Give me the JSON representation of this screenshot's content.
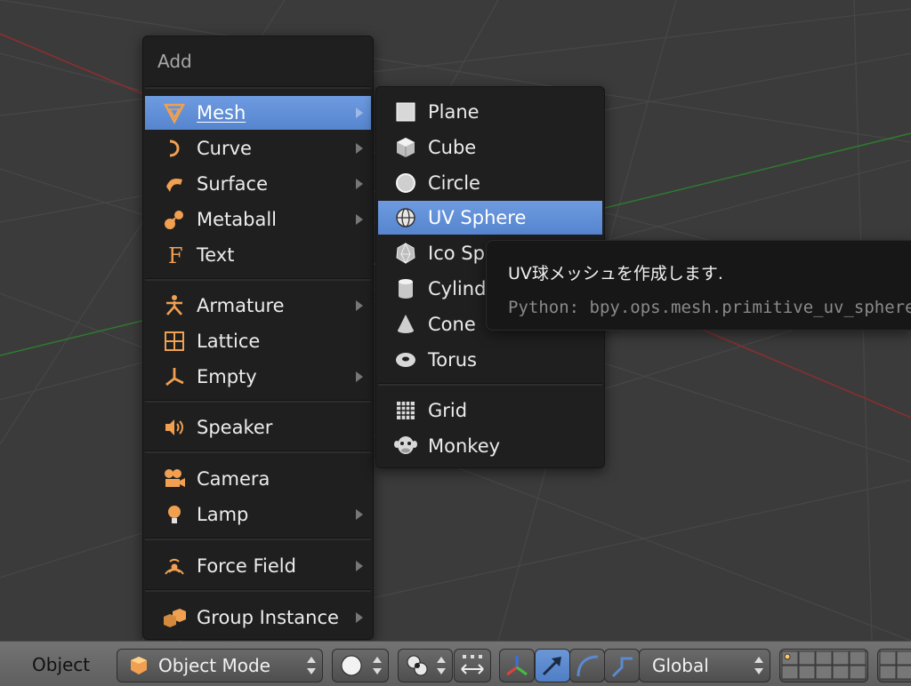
{
  "add_menu": {
    "title": "Add",
    "items": [
      {
        "label": "Mesh",
        "icon": "mesh-icon",
        "submenu": true,
        "active": true
      },
      {
        "label": "Curve",
        "icon": "curve-icon",
        "submenu": true
      },
      {
        "label": "Surface",
        "icon": "surface-icon",
        "submenu": true
      },
      {
        "label": "Metaball",
        "icon": "metaball-icon",
        "submenu": true
      },
      {
        "label": "Text",
        "icon": "text-icon",
        "submenu": false
      },
      {
        "label": "Armature",
        "icon": "armature-icon",
        "submenu": true
      },
      {
        "label": "Lattice",
        "icon": "lattice-icon",
        "submenu": false
      },
      {
        "label": "Empty",
        "icon": "empty-icon",
        "submenu": true
      },
      {
        "label": "Speaker",
        "icon": "speaker-icon",
        "submenu": false
      },
      {
        "label": "Camera",
        "icon": "camera-icon",
        "submenu": false
      },
      {
        "label": "Lamp",
        "icon": "lamp-icon",
        "submenu": true
      },
      {
        "label": "Force Field",
        "icon": "force-field-icon",
        "submenu": true
      },
      {
        "label": "Group Instance",
        "icon": "group-instance-icon",
        "submenu": true
      }
    ]
  },
  "mesh_menu": {
    "items": [
      {
        "label": "Plane",
        "icon": "plane-icon"
      },
      {
        "label": "Cube",
        "icon": "cube-icon"
      },
      {
        "label": "Circle",
        "icon": "circle-icon"
      },
      {
        "label": "UV Sphere",
        "icon": "uv-sphere-icon",
        "active": true
      },
      {
        "label": "Ico Sphere",
        "icon": "ico-sphere-icon"
      },
      {
        "label": "Cylinder",
        "icon": "cylinder-icon"
      },
      {
        "label": "Cone",
        "icon": "cone-icon"
      },
      {
        "label": "Torus",
        "icon": "torus-icon"
      },
      {
        "label": "Grid",
        "icon": "grid-icon"
      },
      {
        "label": "Monkey",
        "icon": "monkey-icon"
      }
    ]
  },
  "tooltip": {
    "title": "UV球メッシュを作成します.",
    "python": "Python: bpy.ops.mesh.primitive_uv_sphere_add()"
  },
  "header": {
    "object_label": "Object",
    "mode": "Object Mode",
    "orientation": "Global"
  },
  "colors": {
    "menu_bg": "#1f1f1f",
    "highlight": "#5d8bd4",
    "viewport_bg": "#3b3b3b",
    "icon_orange": "#f0a050"
  }
}
